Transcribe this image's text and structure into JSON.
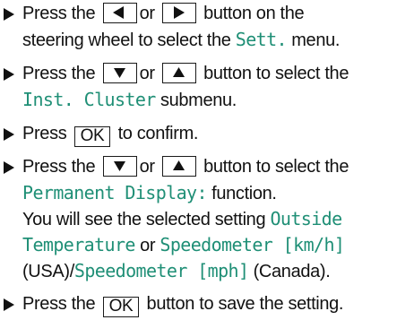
{
  "steps": [
    {
      "l1_a": "Press the",
      "l1_b": "or",
      "l1_c": "button on the",
      "l2_a": "steering wheel to select the",
      "l2_menu": "Sett.",
      "l2_b": "menu."
    },
    {
      "l1_a": "Press the",
      "l1_b": "or",
      "l1_c": "button to select the",
      "l2_menu": "Inst. Cluster",
      "l2_b": "submenu."
    },
    {
      "l1_a": "Press",
      "l1_key": "OK",
      "l1_b": "to confirm."
    },
    {
      "l1_a": "Press the",
      "l1_b": "or",
      "l1_c": "button to select the",
      "l2_func": "Permanent Display:",
      "l2_b": "function.",
      "l3_a": "You will see the selected setting",
      "l3_opt1": "Outside",
      "l4_opt1b": "Temperature",
      "l4_a": "or",
      "l4_opt2": "Speedometer [km/h]",
      "l5_a": "(USA)/",
      "l5_opt3": "Speedometer [mph]",
      "l5_b": "(Canada)."
    },
    {
      "l1_a": "Press the",
      "l1_key": "OK",
      "l1_b": "button to save the setting."
    }
  ],
  "icons": [
    "bullet-arrow-icon",
    "left-arrow-key-icon",
    "right-arrow-key-icon",
    "down-arrow-key-icon",
    "up-arrow-key-icon"
  ],
  "colors": {
    "text": "#111111",
    "display_text": "#1f8f76"
  }
}
